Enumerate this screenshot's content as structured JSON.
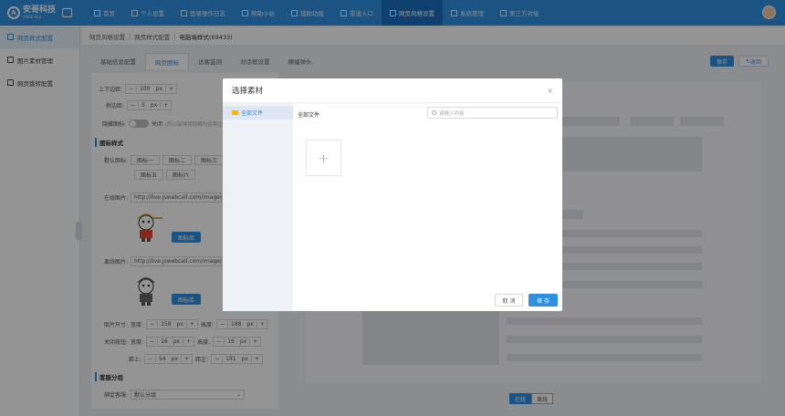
{
  "app": {
    "brand": "安哥科技",
    "brand_sub": "ANGE KEJI"
  },
  "nav": [
    {
      "label": "首页",
      "icon": "home-icon"
    },
    {
      "label": "个人设置",
      "icon": "user-icon"
    },
    {
      "label": "登录操作日志",
      "icon": "log-icon"
    },
    {
      "label": "帮助小站",
      "icon": "help-icon"
    },
    {
      "label": "辅助功能",
      "icon": "tool-icon"
    },
    {
      "label": "渠道入口",
      "icon": "channel-icon"
    },
    {
      "label": "网页风格设置",
      "icon": "style-icon"
    },
    {
      "label": "系统管理",
      "icon": "gear-icon"
    },
    {
      "label": "第三方对接",
      "icon": "link-icon"
    }
  ],
  "sidebar": [
    {
      "label": "网页样式配置"
    },
    {
      "label": "图片素材管理"
    },
    {
      "label": "网页跳转配置"
    }
  ],
  "breadcrumb": {
    "a": "网页风格设置",
    "b": "网页样式配置",
    "c": "电脑端样式(69433)"
  },
  "tabs": [
    {
      "label": "基础信息配置"
    },
    {
      "label": "网页图标"
    },
    {
      "label": "访客监测"
    },
    {
      "label": "对话框设置"
    },
    {
      "label": "横幅弹头"
    }
  ],
  "toolbar": {
    "save": "保存",
    "back": "返回"
  },
  "form": {
    "row1_label": "上下边距:",
    "row1_val": "100",
    "unit": "px",
    "row2_label": "侧边距:",
    "row2_val": "5",
    "hide_label": "隐藏图标:",
    "toggle_text": "关闭",
    "hide_hint": "(所以能够按隐藏与否相互)",
    "section1": "图标样式",
    "default_label": "默认图标:",
    "chips": [
      "图标一",
      "图标二",
      "图标三",
      "图标五",
      "图标六"
    ],
    "online_label": "在线图片:",
    "online_url": "http://live.jswebcall.com/images/float",
    "offline_label": "离线图片:",
    "offline_url": "http://live.jswebcall.com/images/float",
    "upload": "图标库",
    "size_label": "图片尺寸:",
    "w_label": "宽度:",
    "w_val": "158",
    "h_label": "高度:",
    "h_val": "188",
    "close_label": "关闭按钮:",
    "cw_val": "16",
    "ch_val": "16",
    "top_label": "距上:",
    "top_val": "54",
    "left_label": "距左:",
    "left_val": "181",
    "section2": "客服分组",
    "group_label": "绑定客服:",
    "group_val": "默认分组"
  },
  "modal": {
    "title": "选择素材",
    "close": "×",
    "folder": "全部文件",
    "body_label": "全部文件",
    "search_placeholder": "请输入内容",
    "add": "+",
    "cancel": "取 消",
    "save": "保 存"
  },
  "preview": {
    "online": "在线",
    "offline": "离线"
  }
}
